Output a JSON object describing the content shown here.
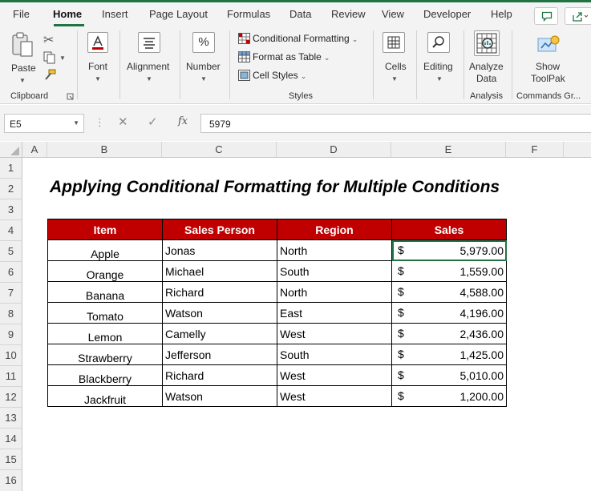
{
  "menu": {
    "tabs": [
      "File",
      "Home",
      "Insert",
      "Page Layout",
      "Formulas",
      "Data",
      "Review",
      "View",
      "Developer",
      "Help"
    ],
    "active": "Home"
  },
  "ribbon": {
    "clipboard": {
      "paste_label": "Paste",
      "group_label": "Clipboard"
    },
    "font": {
      "label": "Font"
    },
    "alignment": {
      "label": "Alignment"
    },
    "number": {
      "label": "Number",
      "icon_glyph": "%"
    },
    "styles": {
      "conditional_formatting": "Conditional Formatting",
      "format_as_table": "Format as Table",
      "cell_styles": "Cell Styles",
      "group_label": "Styles"
    },
    "cells": {
      "label": "Cells"
    },
    "editing": {
      "label": "Editing"
    },
    "analysis": {
      "analyze_line1": "Analyze",
      "analyze_line2": "Data",
      "group_label": "Analysis"
    },
    "commands": {
      "show_line1": "Show",
      "show_line2": "ToolPak",
      "group_label": "Commands Gr..."
    }
  },
  "formula_bar": {
    "name_box": "E5",
    "fx": "fx",
    "value": "5979"
  },
  "grid": {
    "columns": [
      "A",
      "B",
      "C",
      "D",
      "E",
      "F"
    ],
    "rows": [
      "1",
      "2",
      "3",
      "4",
      "5",
      "6",
      "7",
      "8",
      "9",
      "10",
      "11",
      "12",
      "13",
      "14",
      "15",
      "16"
    ]
  },
  "sheet": {
    "title": "Applying Conditional Formatting for Multiple Conditions",
    "headers": {
      "item": "Item",
      "sales_person": "Sales Person",
      "region": "Region",
      "sales": "Sales"
    },
    "currency": "$",
    "rows": [
      {
        "item": "Apple",
        "person": "Jonas",
        "region": "North",
        "sales": "5,979.00"
      },
      {
        "item": "Orange",
        "person": "Michael",
        "region": "South",
        "sales": "1,559.00"
      },
      {
        "item": "Banana",
        "person": "Richard",
        "region": "North",
        "sales": "4,588.00"
      },
      {
        "item": "Tomato",
        "person": "Watson",
        "region": "East",
        "sales": "4,196.00"
      },
      {
        "item": "Lemon",
        "person": "Camelly",
        "region": "West",
        "sales": "2,436.00"
      },
      {
        "item": "Strawberry",
        "person": "Jefferson",
        "region": "South",
        "sales": "1,425.00"
      },
      {
        "item": "Blackberry",
        "person": "Richard",
        "region": "West",
        "sales": "5,010.00"
      },
      {
        "item": "Jackfruit",
        "person": "Watson",
        "region": "West",
        "sales": "1,200.00"
      }
    ]
  },
  "colors": {
    "accent": "#217346",
    "table_header": "#c00000"
  }
}
